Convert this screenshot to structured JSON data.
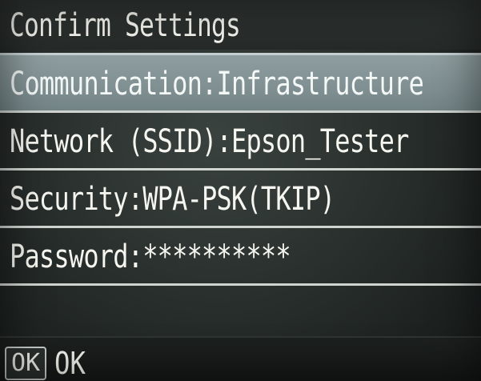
{
  "screen": {
    "title": "Confirm Settings"
  },
  "settings": [
    {
      "label": "Communication:Infrastructure"
    },
    {
      "label": "Network (SSID):Epson_Tester"
    },
    {
      "label": "Security:WPA-PSK(TKIP)"
    },
    {
      "label": "Password:**********"
    }
  ],
  "softkeys": {
    "ok_icon": "OK",
    "ok_label": "OK"
  },
  "colors": {
    "background": "#262c2a",
    "selected_row": "#8f9ea0",
    "text": "#f4f4ee"
  }
}
